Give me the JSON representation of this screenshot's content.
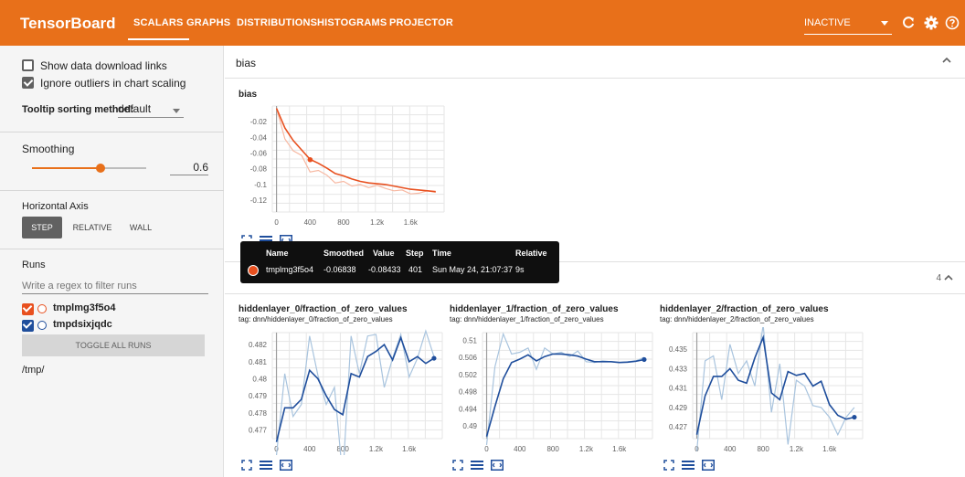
{
  "topbar": {
    "brand": "TensorBoard",
    "tabs": [
      "SCALARS",
      "GRAPHS",
      "DISTRIBUTIONS",
      "HISTOGRAMS",
      "PROJECTOR"
    ],
    "active_tab": "SCALARS",
    "status_select": "INACTIVE",
    "icons": [
      "refresh-icon",
      "gear-icon",
      "help-icon"
    ],
    "color": "#e8701a"
  },
  "sidebar": {
    "show_download_links": {
      "label": "Show data download links",
      "checked": false
    },
    "ignore_outliers": {
      "label": "Ignore outliers in chart scaling",
      "checked": true
    },
    "tooltip_sorting": {
      "label": "Tooltip sorting method:",
      "value": "default"
    },
    "smoothing": {
      "label": "Smoothing",
      "value": "0.6",
      "fraction": 0.6
    },
    "horizontal_axis": {
      "label": "Horizontal Axis",
      "options": [
        "STEP",
        "RELATIVE",
        "WALL"
      ],
      "selected": "STEP"
    },
    "runs": {
      "label": "Runs",
      "filter_placeholder": "Write a regex to filter runs",
      "items": [
        {
          "name": "tmplmg3f5o4",
          "color": "#e8501f",
          "checked": true
        },
        {
          "name": "tmpdsixjqdc",
          "color": "#1f4e9c",
          "checked": true
        }
      ],
      "toggle_label": "TOGGLE ALL RUNS",
      "path": "/tmp/"
    }
  },
  "main": {
    "section1": {
      "title": "bias",
      "collapse_icon": "chevron-up-icon"
    },
    "section2": {
      "count": "4"
    },
    "tooltip": {
      "headers": [
        "Name",
        "Smoothed",
        "Value",
        "Step",
        "Time",
        "Relative"
      ],
      "row": {
        "name": "tmplmg3f5o4",
        "smoothed": "-0.06838",
        "value": "-0.08433",
        "step": "401",
        "time": "Sun May 24, 21:07:37",
        "relative": "9s"
      }
    }
  },
  "chart_data": [
    {
      "type": "line",
      "title": "bias",
      "x_ticks": [
        "0",
        "400",
        "800",
        "1.2k",
        "1.6k"
      ],
      "y_ticks": [
        "-0.02",
        "-0.04",
        "-0.06",
        "-0.08",
        "-0.1",
        "-0.12"
      ],
      "xlim": [
        -50,
        2000
      ],
      "ylim": [
        -0.135,
        0.0
      ],
      "series": [
        {
          "role": "raw",
          "color": "#f7b9a3",
          "x": [
            0,
            100,
            200,
            300,
            400,
            500,
            600,
            700,
            800,
            900,
            1000,
            1100,
            1200,
            1300,
            1400,
            1500,
            1600,
            1700,
            1800,
            1900
          ],
          "y": [
            -0.003,
            -0.042,
            -0.057,
            -0.063,
            -0.084,
            -0.082,
            -0.088,
            -0.098,
            -0.096,
            -0.102,
            -0.1,
            -0.104,
            -0.101,
            -0.105,
            -0.108,
            -0.107,
            -0.112,
            -0.111,
            -0.108,
            -0.11
          ]
        },
        {
          "role": "smoothed",
          "color": "#e8501f",
          "x": [
            0,
            100,
            200,
            300,
            400,
            500,
            600,
            700,
            800,
            900,
            1000,
            1100,
            1200,
            1300,
            1400,
            1500,
            1600,
            1700,
            1800,
            1900
          ],
          "y": [
            -0.003,
            -0.028,
            -0.044,
            -0.056,
            -0.068,
            -0.073,
            -0.079,
            -0.086,
            -0.089,
            -0.093,
            -0.096,
            -0.098,
            -0.099,
            -0.1,
            -0.102,
            -0.104,
            -0.106,
            -0.107,
            -0.108,
            -0.109
          ]
        }
      ],
      "highlight_point": {
        "x": 401,
        "y": -0.06838
      }
    },
    {
      "type": "line",
      "title": "hiddenlayer_0/fraction_of_zero_values",
      "subtitle": "tag: dnn/hiddenlayer_0/fraction_of_zero_values",
      "x_ticks": [
        "0",
        "400",
        "800",
        "1.2k",
        "1.6k"
      ],
      "y_ticks": [
        "0.482",
        "0.481",
        "0.48",
        "0.479",
        "0.478",
        "0.477"
      ],
      "xlim": [
        -50,
        2000
      ],
      "ylim": [
        0.4765,
        0.4827
      ],
      "series": [
        {
          "role": "raw",
          "color": "#a9c4de",
          "x": [
            0,
            100,
            200,
            300,
            400,
            500,
            600,
            700,
            800,
            900,
            1000,
            1100,
            1200,
            1300,
            1400,
            1500,
            1600,
            1700,
            1800,
            1900
          ],
          "y": [
            0.4755,
            0.4803,
            0.4778,
            0.4785,
            0.4825,
            0.4802,
            0.4785,
            0.4795,
            0.4742,
            0.4825,
            0.4803,
            0.4825,
            0.4826,
            0.4795,
            0.4812,
            0.4826,
            0.4801,
            0.4812,
            0.4828,
            0.4813
          ]
        },
        {
          "role": "smoothed",
          "color": "#1f4e9c",
          "x": [
            0,
            100,
            200,
            300,
            400,
            500,
            600,
            700,
            800,
            900,
            1000,
            1100,
            1200,
            1300,
            1400,
            1500,
            1600,
            1700,
            1800,
            1900
          ],
          "y": [
            0.4763,
            0.4783,
            0.4783,
            0.4788,
            0.4805,
            0.48,
            0.479,
            0.4782,
            0.4779,
            0.4803,
            0.4801,
            0.4813,
            0.4816,
            0.482,
            0.4811,
            0.4824,
            0.481,
            0.4813,
            0.4809,
            0.4812
          ]
        }
      ]
    },
    {
      "type": "line",
      "title": "hiddenlayer_1/fraction_of_zero_values",
      "subtitle": "tag: dnn/hiddenlayer_1/fraction_of_zero_values",
      "x_ticks": [
        "0",
        "400",
        "800",
        "1.2k",
        "1.6k"
      ],
      "y_ticks": [
        "0.51",
        "0.506",
        "0.502",
        "0.498",
        "0.494",
        "0.49"
      ],
      "xlim": [
        -50,
        2000
      ],
      "ylim": [
        0.487,
        0.5118
      ],
      "series": [
        {
          "role": "raw",
          "color": "#a9c4de",
          "x": [
            0,
            100,
            200,
            300,
            400,
            500,
            600,
            700,
            800,
            900,
            1000,
            1100,
            1200,
            1300,
            1400,
            1500,
            1600,
            1700,
            1800,
            1900
          ],
          "y": [
            0.4855,
            0.5038,
            0.5115,
            0.5068,
            0.5072,
            0.5082,
            0.5032,
            0.5082,
            0.5068,
            0.5072,
            0.5062,
            0.5075,
            0.505,
            0.5048,
            0.5052,
            0.505,
            0.5048,
            0.505,
            0.5052,
            0.506
          ]
        },
        {
          "role": "smoothed",
          "color": "#1f4e9c",
          "x": [
            0,
            100,
            200,
            300,
            400,
            500,
            600,
            700,
            800,
            900,
            1000,
            1100,
            1200,
            1300,
            1400,
            1500,
            1600,
            1700,
            1800,
            1900
          ],
          "y": [
            0.4875,
            0.4945,
            0.501,
            0.5048,
            0.5056,
            0.5066,
            0.5052,
            0.5062,
            0.5068,
            0.5068,
            0.5066,
            0.5063,
            0.5056,
            0.505,
            0.505,
            0.505,
            0.5048,
            0.5049,
            0.5051,
            0.5055
          ]
        }
      ]
    },
    {
      "type": "line",
      "title": "hiddenlayer_2/fraction_of_zero_values",
      "subtitle": "tag: dnn/hiddenlayer_2/fraction_of_zero_values",
      "x_ticks": [
        "0",
        "400",
        "800",
        "1.2k",
        "1.6k"
      ],
      "y_ticks": [
        "0.435",
        "0.433",
        "0.431",
        "0.429",
        "0.427"
      ],
      "xlim": [
        -50,
        2000
      ],
      "ylim": [
        0.4258,
        0.4367
      ],
      "series": [
        {
          "role": "raw",
          "color": "#a9c4de",
          "x": [
            0,
            100,
            200,
            300,
            400,
            500,
            600,
            700,
            800,
            900,
            1000,
            1100,
            1200,
            1300,
            1400,
            1500,
            1600,
            1700,
            1800,
            1900
          ],
          "y": [
            0.4245,
            0.4338,
            0.4343,
            0.4298,
            0.4355,
            0.4325,
            0.4338,
            0.4312,
            0.4375,
            0.4285,
            0.4335,
            0.4252,
            0.4318,
            0.4312,
            0.4292,
            0.429,
            0.428,
            0.4262,
            0.428,
            0.429
          ]
        },
        {
          "role": "smoothed",
          "color": "#1f4e9c",
          "x": [
            0,
            100,
            200,
            300,
            400,
            500,
            600,
            700,
            800,
            900,
            1000,
            1100,
            1200,
            1300,
            1400,
            1500,
            1600,
            1700,
            1800,
            1900
          ],
          "y": [
            0.4262,
            0.4302,
            0.4322,
            0.4322,
            0.433,
            0.4318,
            0.4315,
            0.4341,
            0.4362,
            0.4305,
            0.4298,
            0.4327,
            0.4323,
            0.4325,
            0.4312,
            0.4317,
            0.4293,
            0.4282,
            0.4278,
            0.428
          ]
        }
      ]
    }
  ]
}
